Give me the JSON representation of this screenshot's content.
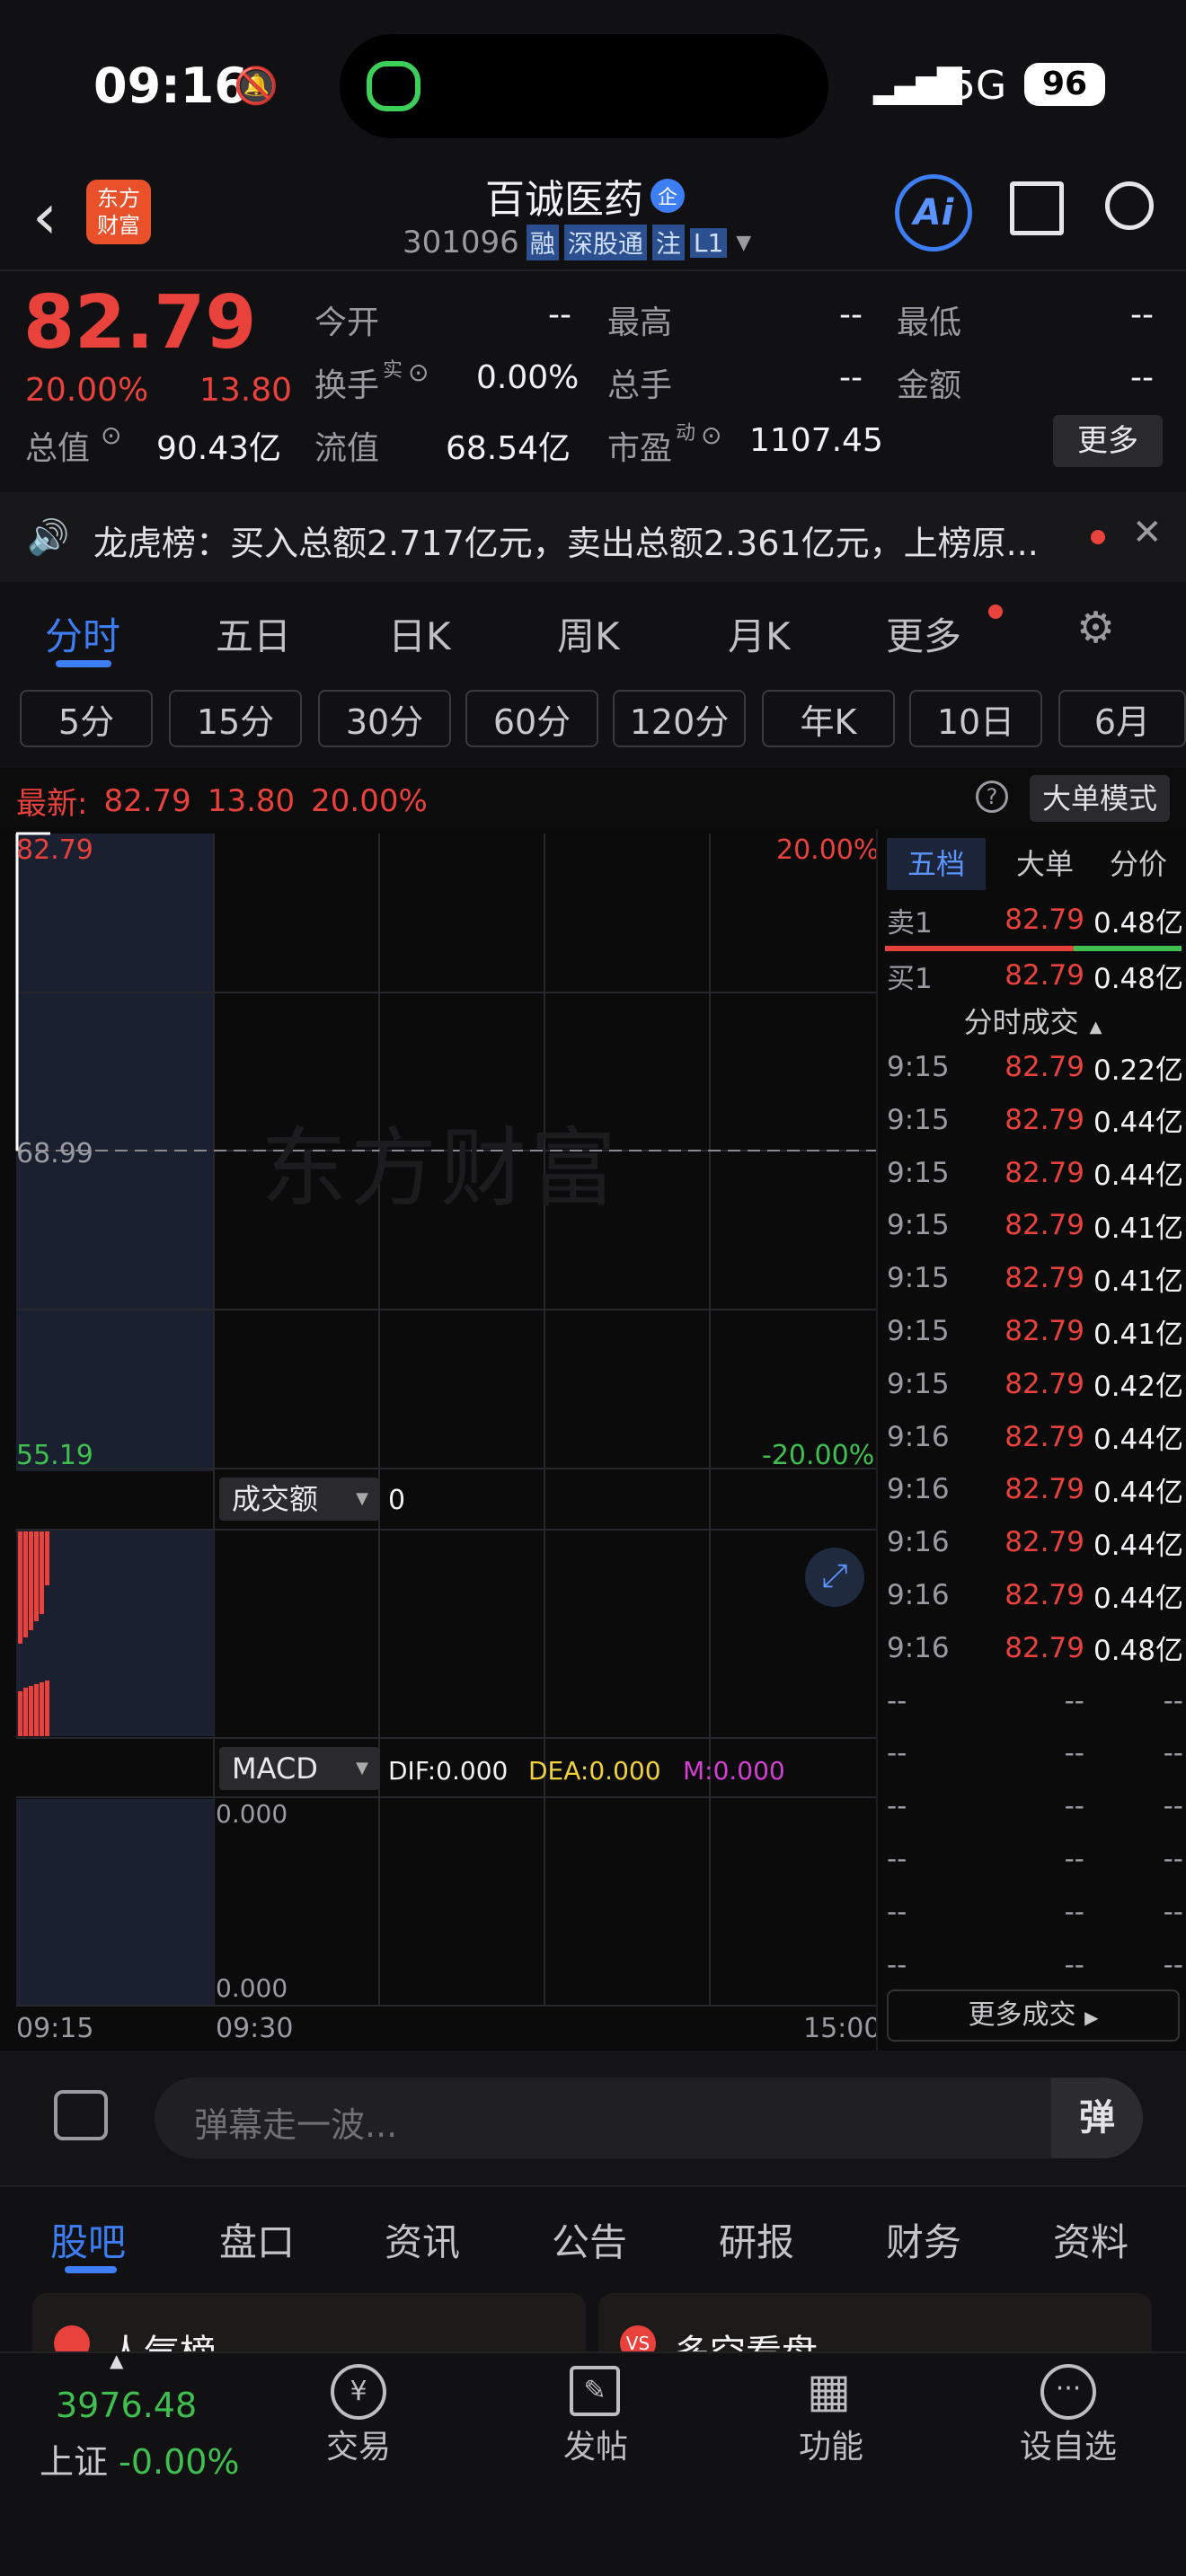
{
  "status": {
    "time": "09:16",
    "network": "5G",
    "battery": "96"
  },
  "nav": {
    "logo_line1": "东方",
    "logo_line2": "财富",
    "stock_name": "百诚医药",
    "stock_badge": "企",
    "code": "301096",
    "tags": [
      "融",
      "深股通",
      "注",
      "L1"
    ],
    "ai_label": "Ai"
  },
  "quote": {
    "price": "82.79",
    "pct": "20.00%",
    "chg": "13.80",
    "row1": [
      {
        "label": "今开",
        "value": "--"
      },
      {
        "label": "最高",
        "value": "--"
      },
      {
        "label": "最低",
        "value": "--"
      }
    ],
    "row2": [
      {
        "label": "换手",
        "sup": "实",
        "value": "0.00%"
      },
      {
        "label": "总手",
        "value": "--"
      },
      {
        "label": "金额",
        "value": "--"
      }
    ],
    "row3": [
      {
        "label": "总值",
        "value": "90.43亿"
      },
      {
        "label": "流值",
        "value": "68.54亿"
      },
      {
        "label": "市盈",
        "sup": "动",
        "value": "1107.45"
      }
    ],
    "more": "更多"
  },
  "notice": {
    "text": "龙虎榜：买入总额2.717亿元，卖出总额2.361亿元，上榜原..."
  },
  "tabs": [
    "分时",
    "五日",
    "日K",
    "周K",
    "月K",
    "更多"
  ],
  "periods": [
    "5分",
    "15分",
    "30分",
    "60分",
    "120分",
    "年K",
    "10日",
    "6月"
  ],
  "latest": {
    "label": "最新:",
    "price": "82.79",
    "chg": "13.80",
    "pct": "20.00%",
    "bigmode": "大单模式"
  },
  "chart": {
    "top_price": "82.79",
    "mid_price": "68.99",
    "low_price": "55.19",
    "top_pct": "20.00%",
    "low_pct": "-20.00%",
    "watermark": "东方财富",
    "vol_label": "成交额",
    "vol_value": "0",
    "macd_label": "MACD",
    "dif": "DIF:0.000",
    "dea": "DEA:0.000",
    "m": "M:0.000",
    "macd_top": "0.000",
    "macd_bottom": "0.000",
    "times": [
      "09:15",
      "09:30",
      "15:00"
    ]
  },
  "side": {
    "tabs": [
      "五档",
      "大单",
      "分价"
    ],
    "sell": {
      "label": "卖1",
      "price": "82.79",
      "vol": "0.48亿"
    },
    "buy": {
      "label": "买1",
      "price": "82.79",
      "vol": "0.48亿"
    },
    "ticks_title": "分时成交",
    "ticks": [
      [
        "9:15",
        "82.79",
        "0.22亿"
      ],
      [
        "9:15",
        "82.79",
        "0.44亿"
      ],
      [
        "9:15",
        "82.79",
        "0.44亿"
      ],
      [
        "9:15",
        "82.79",
        "0.41亿"
      ],
      [
        "9:15",
        "82.79",
        "0.41亿"
      ],
      [
        "9:15",
        "82.79",
        "0.41亿"
      ],
      [
        "9:15",
        "82.79",
        "0.42亿"
      ],
      [
        "9:16",
        "82.79",
        "0.44亿"
      ],
      [
        "9:16",
        "82.79",
        "0.44亿"
      ],
      [
        "9:16",
        "82.79",
        "0.44亿"
      ],
      [
        "9:16",
        "82.79",
        "0.44亿"
      ],
      [
        "9:16",
        "82.79",
        "0.48亿"
      ],
      [
        "--",
        "--",
        "--"
      ],
      [
        "--",
        "--",
        "--"
      ],
      [
        "--",
        "--",
        "--"
      ],
      [
        "--",
        "--",
        "--"
      ],
      [
        "--",
        "--",
        "--"
      ],
      [
        "--",
        "--",
        "--"
      ]
    ],
    "more_trades": "更多成交"
  },
  "danmu": {
    "placeholder": "弹幕走一波...",
    "btn": "弹"
  },
  "subtabs": [
    "股吧",
    "盘口",
    "资讯",
    "公告",
    "研报",
    "财务",
    "资料"
  ],
  "cards": [
    "人气榜",
    "多空看盘"
  ],
  "bottom": {
    "index_value": "3976.48",
    "index_name": "上证",
    "index_pct": "-0.00%",
    "items": [
      "交易",
      "发帖",
      "功能",
      "设自选"
    ]
  },
  "colors": {
    "up": "#e9413b",
    "down": "#3fbf4f",
    "accent": "#3d7ef5",
    "bg": "#111113"
  }
}
